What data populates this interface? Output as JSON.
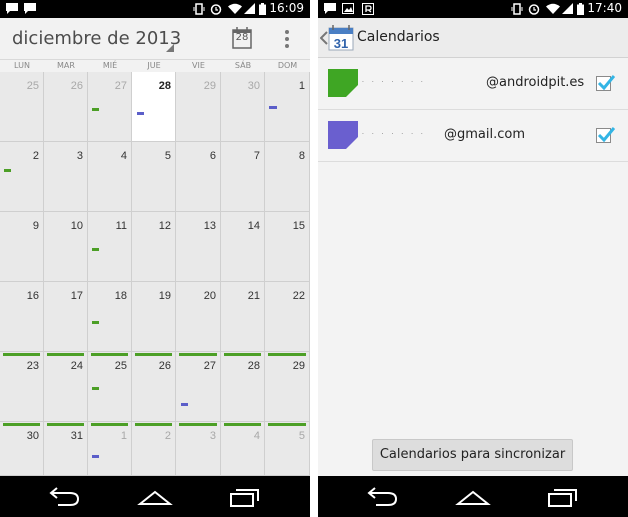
{
  "left_status": {
    "time": "16:09"
  },
  "right_status": {
    "time": "17:40"
  },
  "calendar": {
    "month_title": "diciembre de 2013",
    "today_icon_number": "28",
    "weekdays": [
      "LUN",
      "MAR",
      "MIÉ",
      "JUE",
      "VIE",
      "SÁB",
      "DOM"
    ],
    "weeks": [
      [
        {
          "d": "25",
          "o": true
        },
        {
          "d": "26",
          "o": true
        },
        {
          "d": "27",
          "o": true
        },
        {
          "d": "28",
          "t": true
        },
        {
          "d": "29",
          "o": true
        },
        {
          "d": "30",
          "o": true
        },
        {
          "d": "1"
        }
      ],
      [
        {
          "d": "2"
        },
        {
          "d": "3"
        },
        {
          "d": "4"
        },
        {
          "d": "5"
        },
        {
          "d": "6"
        },
        {
          "d": "7"
        },
        {
          "d": "8"
        }
      ],
      [
        {
          "d": "9"
        },
        {
          "d": "10"
        },
        {
          "d": "11"
        },
        {
          "d": "12"
        },
        {
          "d": "13"
        },
        {
          "d": "14"
        },
        {
          "d": "15"
        }
      ],
      [
        {
          "d": "16"
        },
        {
          "d": "17"
        },
        {
          "d": "18"
        },
        {
          "d": "19"
        },
        {
          "d": "20"
        },
        {
          "d": "21"
        },
        {
          "d": "22"
        }
      ],
      [
        {
          "d": "23"
        },
        {
          "d": "24"
        },
        {
          "d": "25"
        },
        {
          "d": "26"
        },
        {
          "d": "27"
        },
        {
          "d": "28"
        },
        {
          "d": "29"
        }
      ],
      [
        {
          "d": "30"
        },
        {
          "d": "31"
        },
        {
          "d": "1",
          "o": true
        },
        {
          "d": "2",
          "o": true
        },
        {
          "d": "3",
          "o": true
        },
        {
          "d": "4",
          "o": true
        },
        {
          "d": "5",
          "o": true
        }
      ]
    ],
    "event_colors": {
      "green": "#4c9f26",
      "blue": "#5b5ec9"
    }
  },
  "calendars_screen": {
    "title": "Calendarios",
    "app_icon_number": "31",
    "accounts": [
      {
        "email": "@androidpit.es",
        "color": "#3fa624",
        "checked": true
      },
      {
        "email": "@gmail.com",
        "color": "#6a5fcf",
        "checked": true
      }
    ],
    "sync_button_label": "Calendarios para sincronizar"
  },
  "accent_color": "#33b5e5"
}
